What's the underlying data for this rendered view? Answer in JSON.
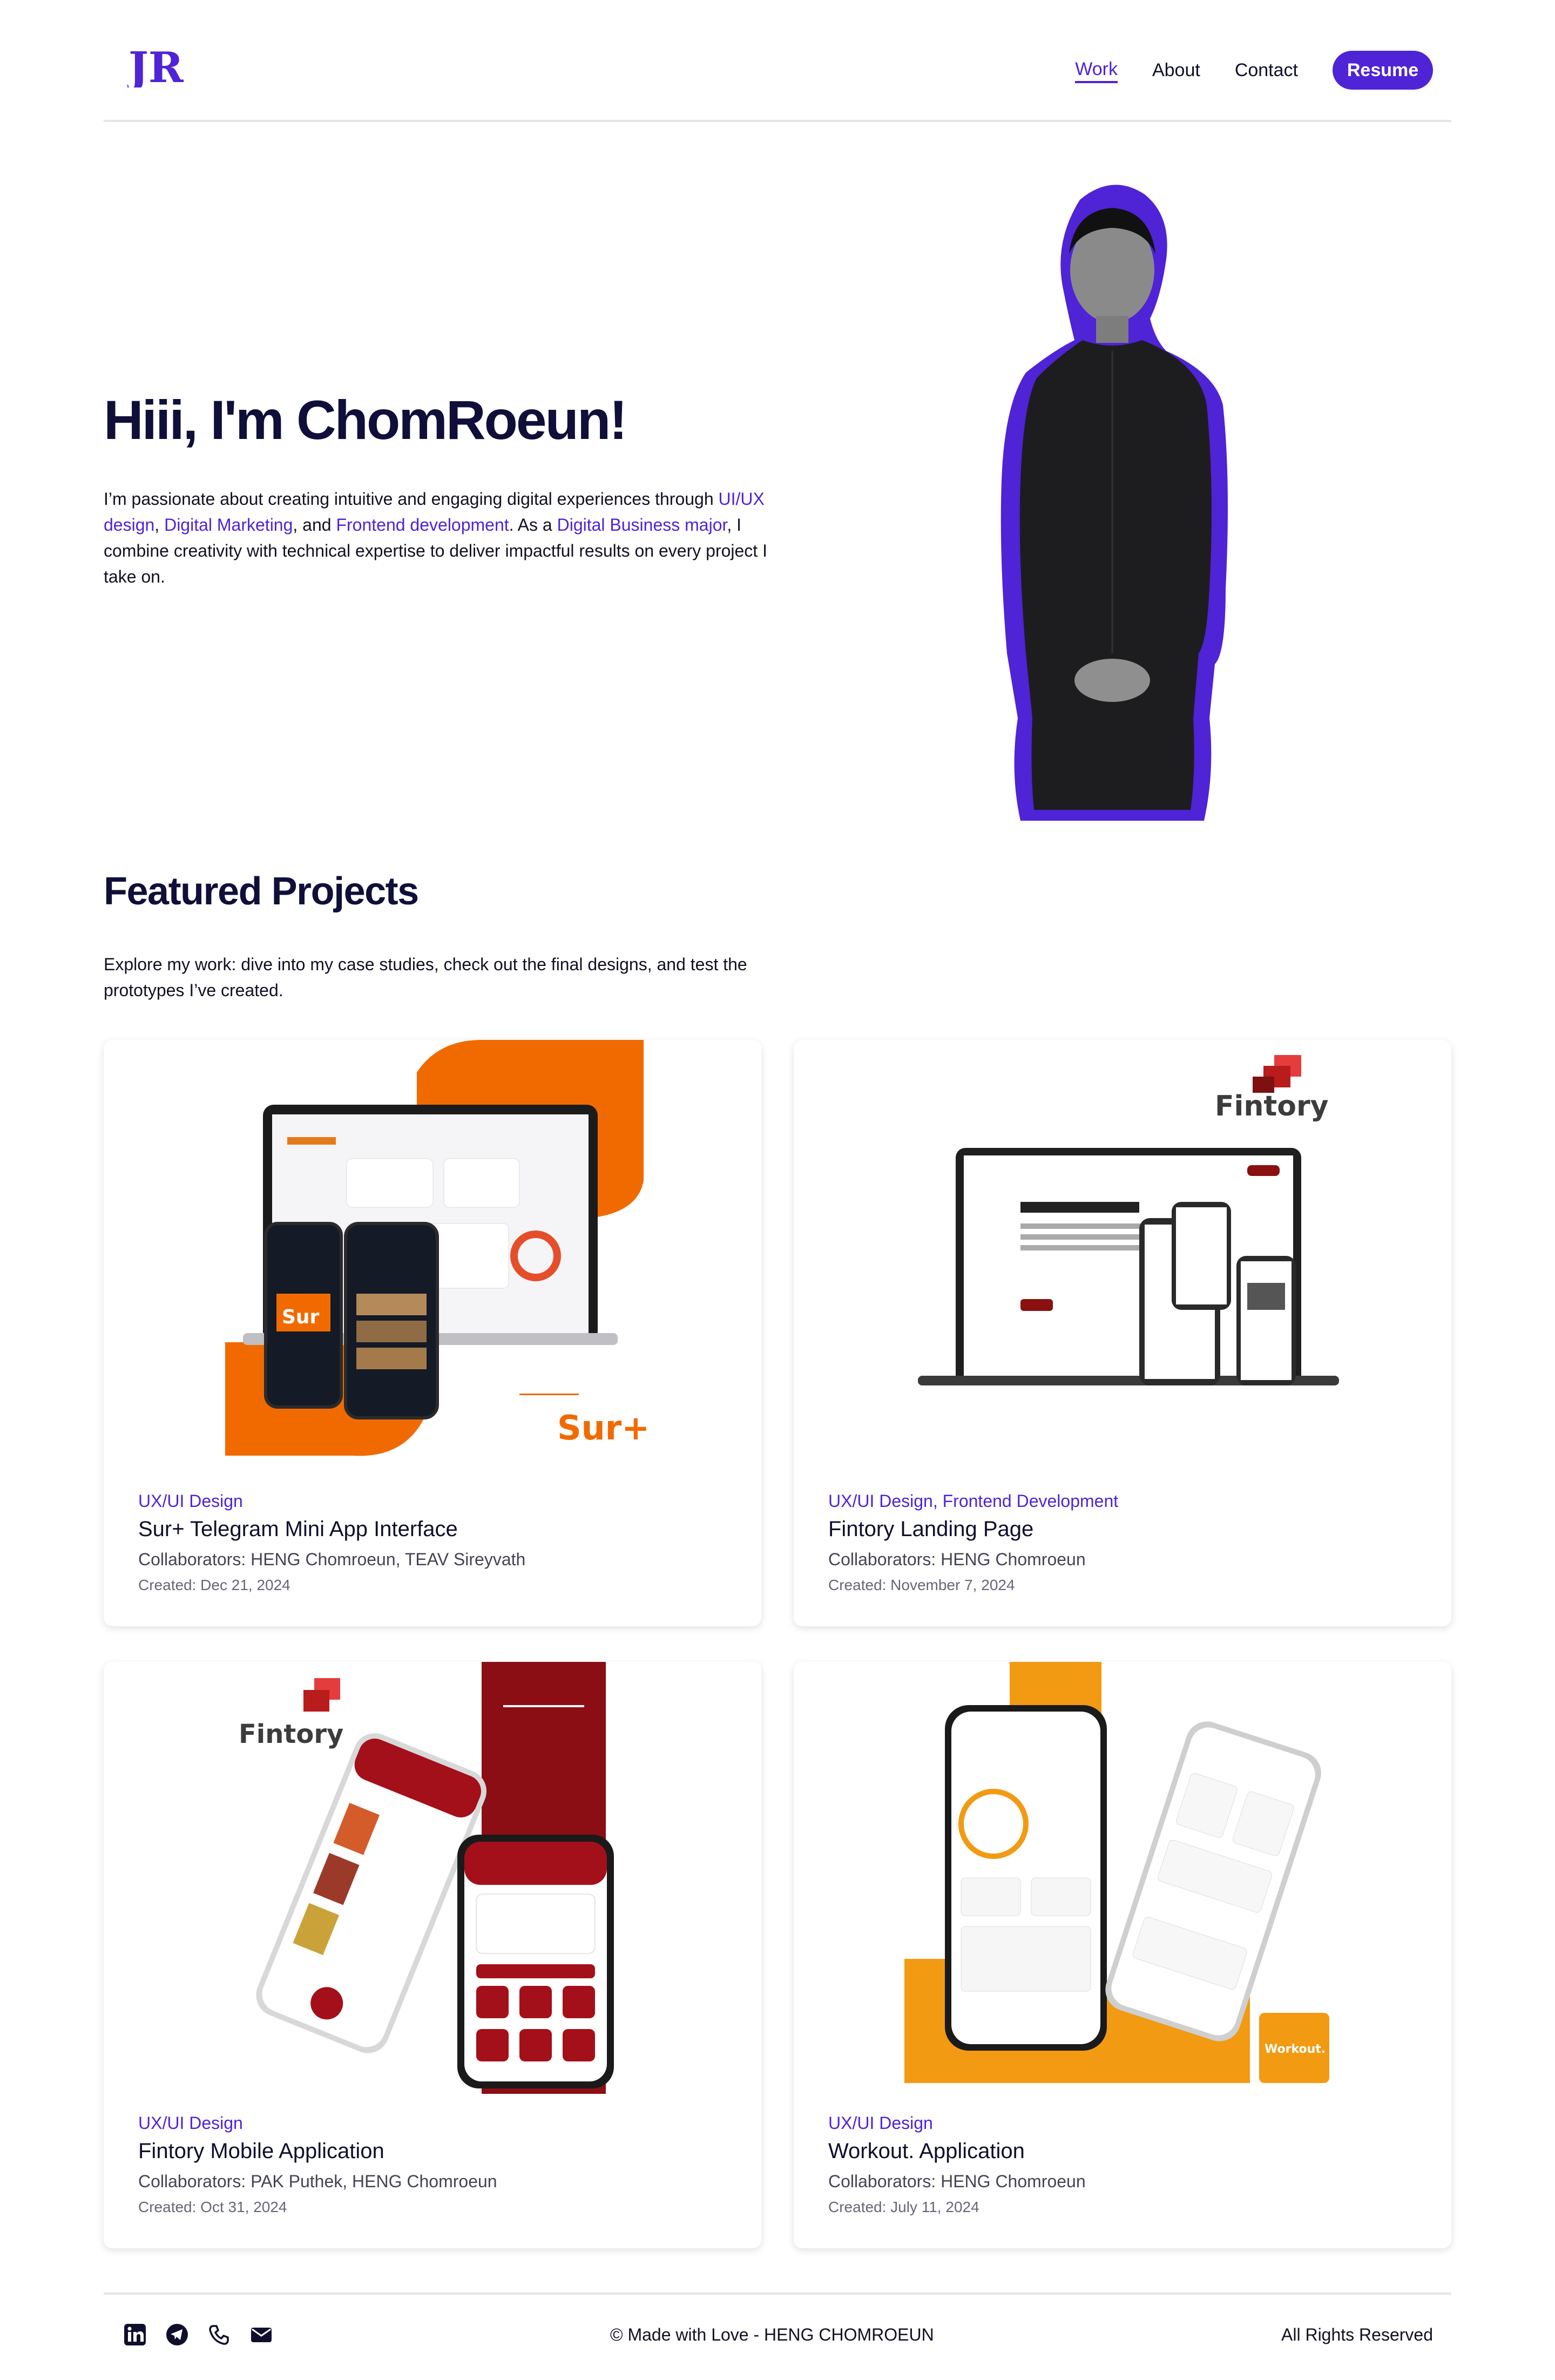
{
  "brand": {
    "logo_text": "JR",
    "accent": "#4f23d6"
  },
  "nav": {
    "work": "Work",
    "about": "About",
    "contact": "Contact",
    "resume": "Resume"
  },
  "hero": {
    "title": "Hiii, I'm ChomRoeun!",
    "p1": "I’m passionate about creating intuitive and engaging digital experiences through ",
    "h1": "UI/UX design",
    "p2": ", ",
    "h2": "Digital Marketing",
    "p3": ", and ",
    "h3": "Frontend development",
    "p4": ". As a ",
    "h4": "Digital Business major",
    "p5": ", I combine creativity with technical expertise to deliver impactful results on every project I take on."
  },
  "featured": {
    "title": "Featured Projects",
    "description": "Explore my work: dive into my case studies, check out the final designs, and test the prototypes I’ve created."
  },
  "projects": [
    {
      "category": "UX/UI Design",
      "title": "Sur+ Telegram Mini App Interface",
      "collaborators": "Collaborators: HENG Chomroeun, TEAV Sireyvath",
      "created": "Created: Dec 21, 2024",
      "art_text": "Sur+"
    },
    {
      "category": "UX/UI Design, Frontend Development",
      "title": "Fintory Landing Page",
      "collaborators": "Collaborators: HENG Chomroeun",
      "created": "Created: November 7, 2024",
      "art_text": "Fintory"
    },
    {
      "category": "UX/UI Design",
      "title": "Fintory Mobile Application",
      "collaborators": "Collaborators: PAK Puthek, HENG Chomroeun",
      "created": "Created: Oct 31, 2024",
      "art_text": "Fintory"
    },
    {
      "category": "UX/UI Design",
      "title": "Workout. Application",
      "collaborators": "Collaborators: HENG Chomroeun",
      "created": "Created: July 11, 2024",
      "art_text": "Workout."
    }
  ],
  "footer": {
    "made": "© Made with Love - HENG CHOMROEUN",
    "rights": "All Rights Reserved",
    "icons": [
      "linkedin-icon",
      "telegram-icon",
      "phone-icon",
      "mail-icon"
    ]
  }
}
